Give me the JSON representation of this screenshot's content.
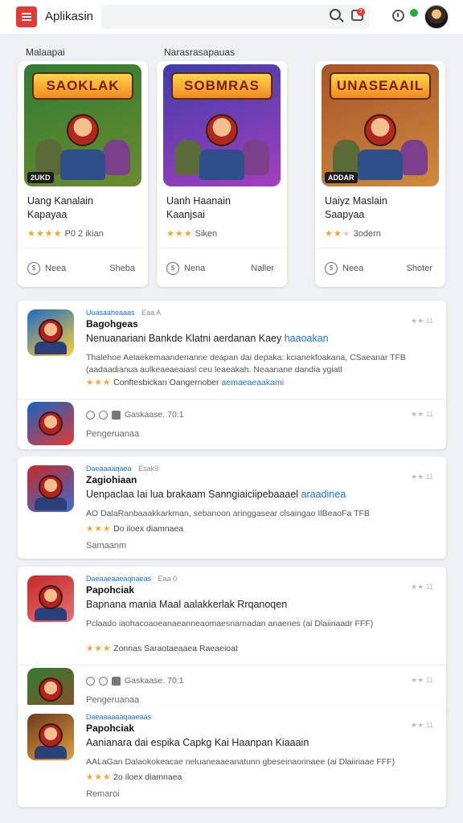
{
  "header": {
    "app_title": "Aplikasin",
    "search_placeholder": "",
    "notif_count": "2",
    "icons": [
      "menu-icon",
      "search-icon",
      "store-icon",
      "clock-icon",
      "avatar"
    ]
  },
  "sections": {
    "left_label": "Malaapai",
    "right_label": "Narasrasapauas"
  },
  "featured": [
    {
      "banner": "SAOKLAK",
      "title_line1": "Uang Kanalain",
      "title_line2": "Kapayaa",
      "stars": 4,
      "rating_text": "P0 2 ikian",
      "action_left": "Neea",
      "action_right": "Sheba",
      "tag": "2UKD",
      "colors": [
        "#2e7d32",
        "#6d8b2f"
      ]
    },
    {
      "banner": "SOBMRAS",
      "title_line1": "Uanh Haanain",
      "title_line2": "Kaanjsai",
      "stars": 3,
      "rating_text": "Siken",
      "action_left": "Nena",
      "action_right": "Naller",
      "tag": "",
      "colors": [
        "#3f3da8",
        "#a43fbf"
      ]
    },
    {
      "banner": "UNASEAAIL",
      "title_line1": "Uaiyz Maslain",
      "title_line2": "Saapyaa",
      "stars": 2,
      "rating_text": "3odern",
      "action_left": "Neea",
      "action_right": "Shoter",
      "tag": "ADDAR",
      "colors": [
        "#a8542a",
        "#cf8a3c"
      ]
    }
  ],
  "list": [
    {
      "category": "Uuasaaheaaas",
      "category_note": "Eaa A",
      "name": "Bagohgeas",
      "desc_main": "Nenuanariani Bankde Klatni aerdanan Kaey ",
      "desc_accent": "haaoakan",
      "body": "Thalehoe Aelaekemaandenanne deapan dai depaka: kcianekfoakana, CSaeanar TFB (aadaadianua aulkeaeaeaiasl ceu leaeakah. Neaanane dandia ygiatl",
      "stars": 3,
      "rate_text": "Conftesbickan Oangernober ",
      "rate_accent": "aemaeaeaakami",
      "meta": "11",
      "sub_text": "Gaskaase. 70:1",
      "sub_meta": "11",
      "sub_foot": "Pengeruanaa",
      "icon_colors": [
        "#1c6bc9",
        "#ffcf33"
      ],
      "sub_icon_colors": [
        "#1565c0",
        "#e53935"
      ]
    },
    {
      "category": "Daeaaaaqaea",
      "category_note": "Esak9",
      "name": "Zagiohiaan",
      "desc_main": "Uenpaclaa Iai lua brakaam Sanngiaiciipebaaael ",
      "desc_accent": "araadinea",
      "body": "AO DalaRanbaaakkarkman, sebanoon aringgasear clsaingao IlBeaoFa TFB",
      "stars": 3,
      "rate_text": "Do iloex diamnaea",
      "rate_accent": "",
      "meta": "11",
      "foot": "Samaanm",
      "icon_colors": [
        "#c62828",
        "#3a6fd6"
      ]
    },
    {
      "category": "Daeaaeaaeaqnaeas",
      "category_note": "Eaa 0",
      "name": "Papohciak",
      "desc_main": "Bapnana mania Maal aalakkerlak Rrqanoqen",
      "desc_accent": "",
      "body": "Pclaado iaohacoaoeanaeanneaomaesnarnadan anaenes (ai Dlaiiriaadr FFF)",
      "stars": 3,
      "rate_text": "Zonnas Saraotaeaaea Raeaeioat",
      "rate_accent": "",
      "meta": "11",
      "sub_text": "Gaskaase. 70:1",
      "sub_meta": "11",
      "sub_foot": "Pengeruanaa",
      "icon_colors": [
        "#c62828",
        "#e57373"
      ],
      "sub_icon_colors": [
        "#2e7d32",
        "#8d4f2a"
      ]
    },
    {
      "category": "Daeaaaaaaqaaeaas",
      "category_note": "",
      "name": "Papohciak",
      "desc_main": "Aanianara dai espika Capkg Kai Haanpan Kiaaain",
      "desc_accent": "",
      "body": "AALaGan Dalaokokeacae neluaneaaeanatunn gbeseinaorinaee (ai Dlaiiriaae FFF)",
      "stars": 3,
      "rate_text": "2o iloex diamnaea",
      "rate_accent": "",
      "meta": "11",
      "foot": "Remaroi",
      "icon_colors": [
        "#6b3a1e",
        "#e0a040"
      ]
    }
  ]
}
